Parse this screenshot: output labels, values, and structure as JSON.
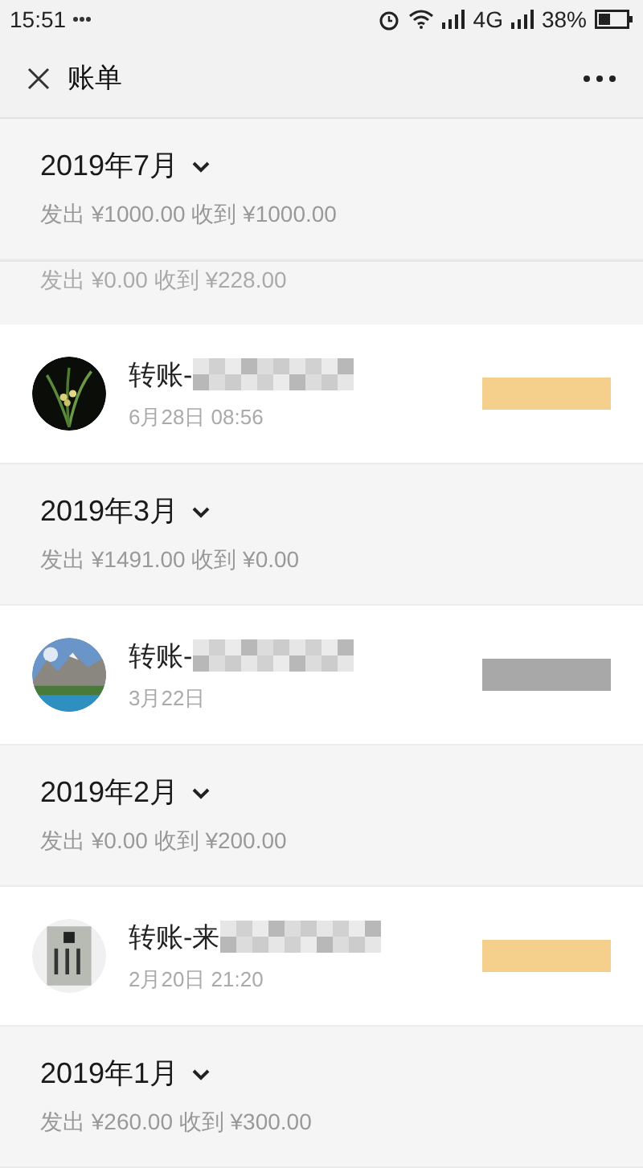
{
  "status_bar": {
    "time": "15:51",
    "network": "4G",
    "battery": "38%"
  },
  "header": {
    "title": "账单"
  },
  "items": [
    {
      "kind": "month",
      "title": "2019年7月",
      "summary": "发出 ¥1000.00 收到 ¥1000.00"
    },
    {
      "kind": "summary",
      "summary": "发出 ¥0.00 收到 ¥228.00"
    },
    {
      "kind": "transaction",
      "title": "转账-",
      "time": "6月28日 08:56",
      "color": "#f5d08c"
    },
    {
      "kind": "month",
      "title": "2019年3月",
      "summary": "发出 ¥1491.00 收到 ¥0.00"
    },
    {
      "kind": "transaction",
      "title": "转账-",
      "time": "3月22日",
      "color": "#a8a8a8"
    },
    {
      "kind": "month",
      "title": "2019年2月",
      "summary": "发出 ¥0.00 收到 ¥200.00"
    },
    {
      "kind": "transaction",
      "title": "转账-来",
      "time": "2月20日 21:20",
      "color": "#f5d08c"
    },
    {
      "kind": "month",
      "title": "2019年1月",
      "summary": "发出 ¥260.00 收到 ¥300.00"
    }
  ]
}
